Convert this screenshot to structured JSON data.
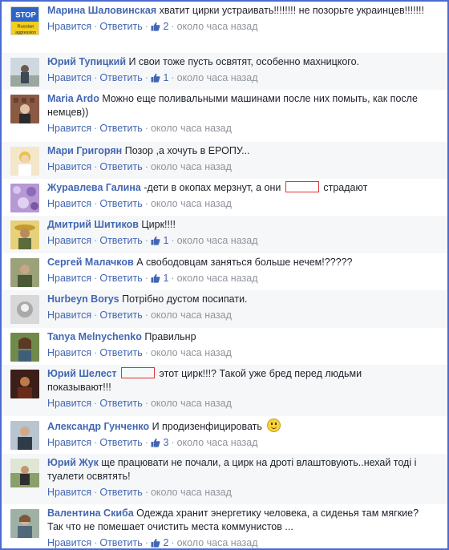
{
  "actions": {
    "like": "Нравится",
    "reply": "Ответить",
    "separator": "·"
  },
  "comments": [
    {
      "author": "Марина Шаловинская",
      "text": "хватит цирки устраивать!!!!!!!! не позорьте украинцев!!!!!!!",
      "likes": "2",
      "time": "около часа назад",
      "avatar_text": [
        "STOP",
        "Russian",
        "aggression"
      ]
    },
    {
      "author": "Юрий Тупицкий",
      "text": "И свои тоже пусть освятят, особенно махницкого.",
      "likes": "1",
      "time": "около часа назад"
    },
    {
      "author": "Maria Ardo",
      "text": "Можно еще поливальными машинами после них помыть, как после немцев))",
      "time": "около часа назад"
    },
    {
      "author": "Мари Григорян",
      "text": "Позор ,а хочуть в ЕРОПУ...",
      "time": "около часа назад"
    },
    {
      "author": "Журавлева Галина",
      "text_before": "-дети в окопах мерзнут, а они",
      "text_after": "страдают",
      "time": "около часа назад"
    },
    {
      "author": "Дмитрий Шитиков",
      "text": "Цирк!!!!",
      "likes": "1",
      "time": "около часа назад"
    },
    {
      "author": "Сергей Малачков",
      "text": "А свободовцам заняться больше нечем!?????",
      "likes": "1",
      "time": "около часа назад"
    },
    {
      "author": "Hurbeyn Borys",
      "text": "Потрібно дустом посипати.",
      "time": "около часа назад"
    },
    {
      "author": "Tanya Melnychenko",
      "text": "Правильнр",
      "time": "около часа назад"
    },
    {
      "author": "Юрий Шелест",
      "text_after": "этот цирк!!!? Такой уже бред перед людьми показывают!!!",
      "time": "около часа назад"
    },
    {
      "author": "Александр Гунченко",
      "text": "И продизенфицировать",
      "likes": "3",
      "time": "около часа назад",
      "emoji": "smile-emoji"
    },
    {
      "author": "Юрий Жук",
      "text": "ще працювати не почали, а цирк на дроті влаштовують..нехай тоді і туалети освятять!",
      "time": "около часа назад"
    },
    {
      "author": "Валентина Скиба",
      "text": "Одежда хранит энергетику человека, а сиденья там мягкие? Так что не помешает очистить места коммунистов ...",
      "likes": "2",
      "time": "около часа назад"
    }
  ],
  "colors": {
    "link": "#4267b2",
    "meta": "#90949c",
    "text": "#1d2129",
    "frame_border": "#4a6bd0",
    "redaction_box": "#e03030"
  }
}
